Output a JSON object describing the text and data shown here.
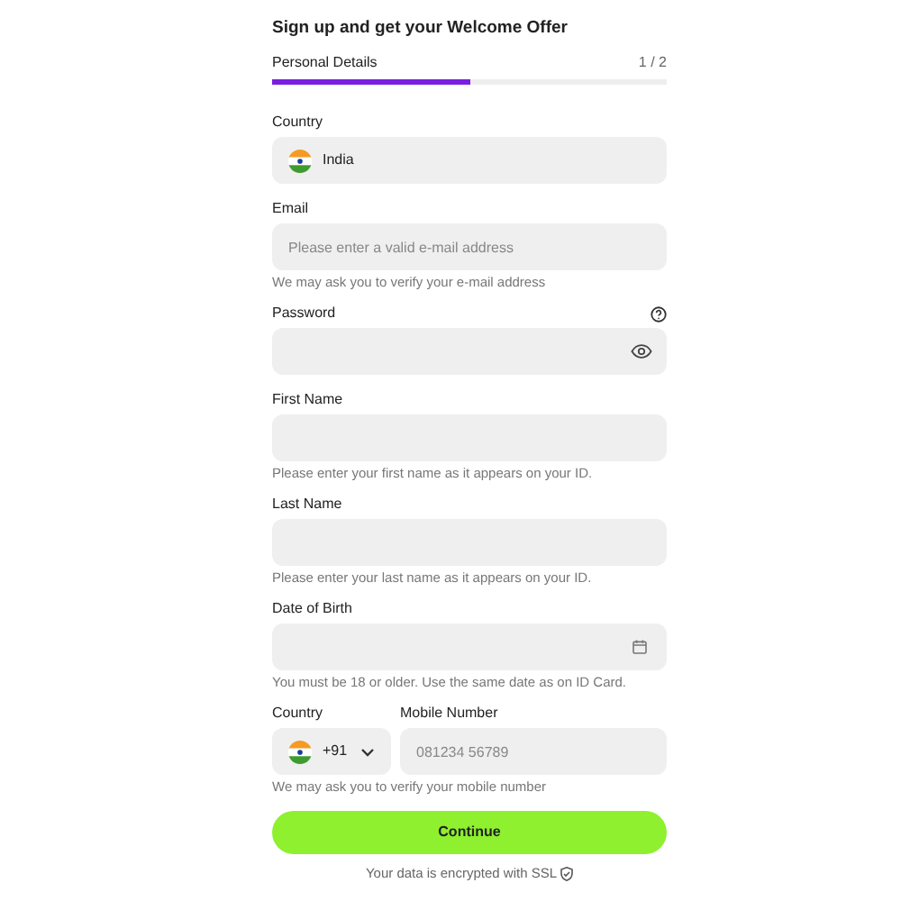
{
  "title": "Sign up and get your Welcome Offer",
  "progress": {
    "label": "Personal Details",
    "step": "1 / 2",
    "level": 0.5
  },
  "fields": [
    {
      "kind": "country",
      "label": "Country",
      "value": "India"
    },
    {
      "kind": "text",
      "label": "Email",
      "placeholder": "Please enter a valid e-mail address",
      "hint": "We may ask you to verify your e-mail address"
    },
    {
      "kind": "password",
      "label": "Password"
    },
    {
      "kind": "text",
      "label": "First Name",
      "hint": "Please enter your first name as it appears on your ID."
    },
    {
      "kind": "text",
      "label": "Last Name",
      "hint": "Please enter your last name as it appears on your ID."
    },
    {
      "kind": "date",
      "label": "Date of Birth",
      "hint": "You must be 18 or older. Use the same date as on ID Card."
    },
    {
      "kind": "phone",
      "label": "Country",
      "code": "+91",
      "number_label": "Mobile Number",
      "placeholder": "081234 56789",
      "hint": "We may ask you to verify your mobile number"
    }
  ],
  "button": "Continue",
  "footer": "Your data is encrypted with SSL"
}
